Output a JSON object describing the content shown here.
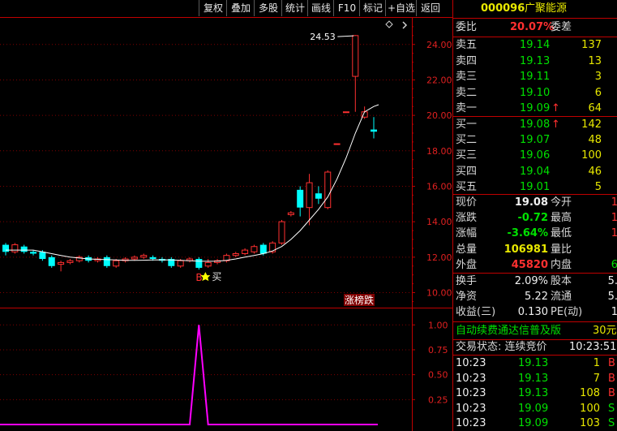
{
  "toolbar": {
    "buttons": [
      "复权",
      "叠加",
      "多股",
      "统计",
      "画线",
      "F10",
      "标记",
      "+自选",
      "返回"
    ]
  },
  "stock": {
    "code": "000096",
    "name": "广聚能源"
  },
  "ratio": {
    "label": "委比",
    "value": "20.07%",
    "label2": "委差"
  },
  "asks": [
    {
      "label": "卖五",
      "price": "19.14",
      "vol": "137",
      "arrow": ""
    },
    {
      "label": "卖四",
      "price": "19.13",
      "vol": "13",
      "arrow": ""
    },
    {
      "label": "卖三",
      "price": "19.11",
      "vol": "3",
      "arrow": ""
    },
    {
      "label": "卖二",
      "price": "19.10",
      "vol": "6",
      "arrow": ""
    },
    {
      "label": "卖一",
      "price": "19.09",
      "vol": "64",
      "arrow": "↑"
    }
  ],
  "bids": [
    {
      "label": "买一",
      "price": "19.08",
      "vol": "142",
      "arrow": "↑"
    },
    {
      "label": "买二",
      "price": "19.07",
      "vol": "48",
      "arrow": ""
    },
    {
      "label": "买三",
      "price": "19.06",
      "vol": "100",
      "arrow": ""
    },
    {
      "label": "买四",
      "price": "19.04",
      "vol": "46",
      "arrow": ""
    },
    {
      "label": "买五",
      "price": "19.01",
      "vol": "5",
      "arrow": ""
    }
  ],
  "quote": [
    {
      "l1": "现价",
      "v1": "19.08",
      "l2": "今开",
      "v2": "1"
    },
    {
      "l1": "涨跌",
      "v1": "-0.72",
      "l2": "最高",
      "v2": "1"
    },
    {
      "l1": "涨幅",
      "v1": "-3.64%",
      "l2": "最低",
      "v2": "1"
    },
    {
      "l1": "总量",
      "v1": "106981",
      "l2": "量比",
      "v2": ""
    },
    {
      "l1": "外盘",
      "v1": "45820",
      "l2": "内盘",
      "v2": "6"
    }
  ],
  "stats": [
    {
      "l1": "换手",
      "v1": "2.09%",
      "l2": "股本",
      "v2": "5."
    },
    {
      "l1": "净资",
      "v1": "5.22",
      "l2": "流通",
      "v2": "5."
    },
    {
      "l1": "收益(三)",
      "v1": "0.130",
      "l2": "PE(动)",
      "v2": "1"
    }
  ],
  "promo": {
    "text": "自动续费通达信普及版",
    "price": "30元"
  },
  "trade_status": {
    "label": "交易状态: 连续竞价",
    "time": "10:23:51"
  },
  "ticks": [
    {
      "time": "10:23",
      "price": "19.13",
      "vol": "1",
      "side": "B"
    },
    {
      "time": "10:23",
      "price": "19.13",
      "vol": "7",
      "side": "B"
    },
    {
      "time": "10:23",
      "price": "19.13",
      "vol": "108",
      "side": "B"
    },
    {
      "time": "10:23",
      "price": "19.09",
      "vol": "100",
      "side": "S"
    },
    {
      "time": "10:23",
      "price": "19.09",
      "vol": "103",
      "side": "S"
    }
  ],
  "chart_data": [
    {
      "type": "candlestick",
      "ylim": [
        9.2,
        25.5
      ],
      "y_ticks": [
        "24.00",
        "22.00",
        "20.00",
        "18.00",
        "16.00",
        "14.00",
        "12.00",
        "10.00"
      ],
      "y_tick_values": [
        24,
        22,
        20,
        18,
        16,
        14,
        12,
        10
      ],
      "annotations": {
        "high_label": "24.53",
        "buy_marker": "B",
        "buy_text": "买",
        "limit_badge": "涨榜跌"
      },
      "candles": [
        {
          "o": 12.7,
          "c": 12.3,
          "h": 12.8,
          "l": 12.1
        },
        {
          "o": 12.3,
          "c": 12.7,
          "h": 12.8,
          "l": 12.2
        },
        {
          "o": 12.6,
          "c": 12.3,
          "h": 12.7,
          "l": 12.2
        },
        {
          "o": 12.3,
          "c": 12.2,
          "h": 12.4,
          "l": 12.1
        },
        {
          "o": 12.3,
          "c": 11.9,
          "h": 12.4,
          "l": 11.8
        },
        {
          "o": 12.0,
          "c": 11.5,
          "h": 12.1,
          "l": 11.4
        },
        {
          "o": 11.6,
          "c": 11.7,
          "h": 11.8,
          "l": 11.2
        },
        {
          "o": 11.7,
          "c": 11.8,
          "h": 11.9,
          "l": 11.6
        },
        {
          "o": 11.8,
          "c": 12.0,
          "h": 12.1,
          "l": 11.7
        },
        {
          "o": 12.0,
          "c": 11.8,
          "h": 12.1,
          "l": 11.7
        },
        {
          "o": 11.8,
          "c": 11.9,
          "h": 12.0,
          "l": 11.7
        },
        {
          "o": 12.0,
          "c": 11.5,
          "h": 12.1,
          "l": 11.4
        },
        {
          "o": 11.5,
          "c": 11.8,
          "h": 11.9,
          "l": 11.4
        },
        {
          "o": 11.8,
          "c": 11.9,
          "h": 12.0,
          "l": 11.7
        },
        {
          "o": 11.9,
          "c": 12.0,
          "h": 12.1,
          "l": 11.8
        },
        {
          "o": 12.0,
          "c": 12.1,
          "h": 12.2,
          "l": 11.9
        },
        {
          "o": 12.0,
          "c": 11.9,
          "h": 12.1,
          "l": 11.8
        },
        {
          "o": 11.9,
          "c": 11.8,
          "h": 12.0,
          "l": 11.7
        },
        {
          "o": 11.9,
          "c": 11.5,
          "h": 12.0,
          "l": 11.4
        },
        {
          "o": 11.5,
          "c": 11.8,
          "h": 11.9,
          "l": 11.4
        },
        {
          "o": 11.8,
          "c": 11.9,
          "h": 12.0,
          "l": 11.7
        },
        {
          "o": 11.9,
          "c": 11.4,
          "h": 12.0,
          "l": 11.3
        },
        {
          "o": 11.5,
          "c": 11.7,
          "h": 11.9,
          "l": 11.4
        },
        {
          "o": 11.7,
          "c": 11.8,
          "h": 11.9,
          "l": 11.6
        },
        {
          "o": 11.8,
          "c": 12.1,
          "h": 12.2,
          "l": 11.7
        },
        {
          "o": 12.1,
          "c": 12.2,
          "h": 12.3,
          "l": 12.0
        },
        {
          "o": 12.2,
          "c": 12.4,
          "h": 12.5,
          "l": 12.1
        },
        {
          "o": 12.3,
          "c": 12.6,
          "h": 12.7,
          "l": 12.2
        },
        {
          "o": 12.7,
          "c": 12.2,
          "h": 12.8,
          "l": 12.1
        },
        {
          "o": 12.3,
          "c": 12.8,
          "h": 12.9,
          "l": 12.2
        },
        {
          "o": 12.8,
          "c": 14.0,
          "h": 14.1,
          "l": 12.7
        },
        {
          "o": 14.4,
          "c": 14.5,
          "h": 14.6,
          "l": 14.3
        },
        {
          "o": 15.8,
          "c": 14.8,
          "h": 16.0,
          "l": 14.3
        },
        {
          "o": 14.8,
          "c": 16.2,
          "h": 16.7,
          "l": 13.8
        },
        {
          "o": 15.6,
          "c": 15.3,
          "h": 16.0,
          "l": 15.0
        },
        {
          "o": 14.8,
          "c": 16.8,
          "h": 16.9,
          "l": 14.7
        },
        {
          "o": 18.4,
          "c": 18.4,
          "h": 18.4,
          "l": 18.4
        },
        {
          "o": 20.2,
          "c": 20.2,
          "h": 20.2,
          "l": 20.2
        },
        {
          "o": 22.2,
          "c": 24.5,
          "h": 24.53,
          "l": 20.2
        },
        {
          "o": 19.9,
          "c": 20.2,
          "h": 20.5,
          "l": 19.8
        },
        {
          "o": 19.2,
          "c": 19.08,
          "h": 19.9,
          "l": 18.7
        }
      ],
      "ma": [
        12.4,
        12.4,
        12.4,
        12.4,
        12.3,
        12.2,
        12.1,
        12.0,
        11.95,
        11.9,
        11.88,
        11.86,
        11.84,
        11.82,
        11.82,
        11.83,
        11.84,
        11.85,
        11.84,
        11.82,
        11.8,
        11.78,
        11.77,
        11.78,
        11.82,
        11.9,
        12.0,
        12.1,
        12.2,
        12.35,
        12.6,
        13.0,
        13.5,
        14.1,
        14.7,
        15.4,
        16.4,
        17.6,
        19.0,
        20.2,
        20.5
      ]
    },
    {
      "type": "line",
      "ylim": [
        0,
        1.1
      ],
      "y_ticks": [
        "1.00",
        "0.75",
        "0.50",
        "0.25"
      ],
      "y_tick_values": [
        1.0,
        0.75,
        0.5,
        0.25
      ],
      "values": [
        0,
        0,
        0,
        0,
        0,
        0,
        0,
        0,
        0,
        0,
        0,
        0,
        0,
        0,
        0,
        0,
        0,
        0,
        0,
        0,
        0,
        1,
        0,
        0,
        0,
        0,
        0,
        0,
        0,
        0,
        0,
        0,
        0,
        0,
        0,
        0,
        0,
        0,
        0,
        0,
        0
      ]
    }
  ],
  "colors": {
    "up": "#ff3030",
    "down": "#00ffff",
    "ma": "#ffffff",
    "indicator": "#ff00ff",
    "border": "#c00000"
  }
}
